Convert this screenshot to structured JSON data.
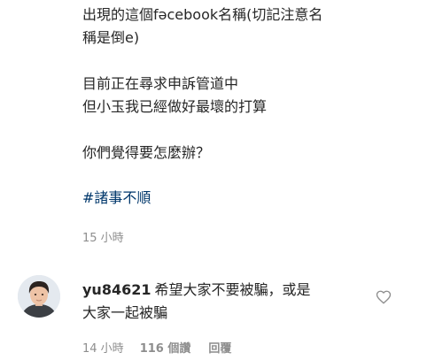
{
  "post": {
    "caption_lines": [
      "出現的這個fəcebook名稱(切記注意名",
      "稱是倒e)",
      "",
      "目前正在尋求申訴管道中",
      "但小玉我已經做好最壞的打算",
      "",
      "你們覺得要怎麼辦？"
    ],
    "hashtag": "#諸事不順",
    "time": "15 小時"
  },
  "comment": {
    "username": "yu84621",
    "text_line1": "希望大家不要被騙，或是",
    "text_line2": "大家一起被騙",
    "time": "14 小時",
    "likes": "116 個讚",
    "reply_label": "回覆",
    "like_icon": "heart-icon"
  }
}
